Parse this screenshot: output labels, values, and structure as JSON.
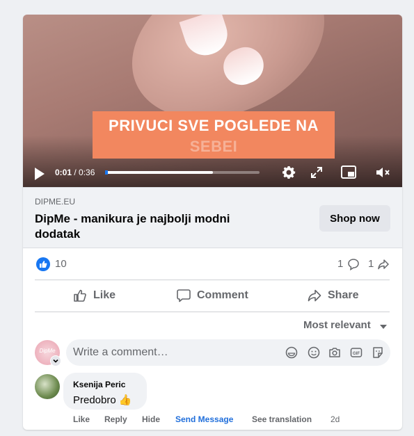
{
  "video": {
    "banner_line1": "PRIVUCI SVE POGLEDE NA",
    "banner_line2": "SEBEI",
    "time_current": "0:01",
    "time_sep": " / ",
    "time_total": "0:36",
    "progress": 0.7
  },
  "link": {
    "domain": "DIPME.EU",
    "title": "DipMe - manikura je najbolji modni dodatak",
    "cta": "Shop now"
  },
  "stats": {
    "reactions": "10",
    "comments": "1",
    "shares": "1"
  },
  "actions": {
    "like": "Like",
    "comment": "Comment",
    "share": "Share"
  },
  "sort": {
    "label": "Most relevant"
  },
  "composer": {
    "placeholder": "Write a comment…",
    "avatar_text": "DipMe"
  },
  "comment": {
    "author": "Ksenija Peric",
    "text": "Predobro",
    "emoji": "👍",
    "meta": {
      "like": "Like",
      "reply": "Reply",
      "hide": "Hide",
      "send": "Send Message",
      "translate": "See translation",
      "time": "2d"
    }
  },
  "colors": {
    "accent": "#1877f2",
    "banner": "#f2875f",
    "link": "#216fdb"
  }
}
